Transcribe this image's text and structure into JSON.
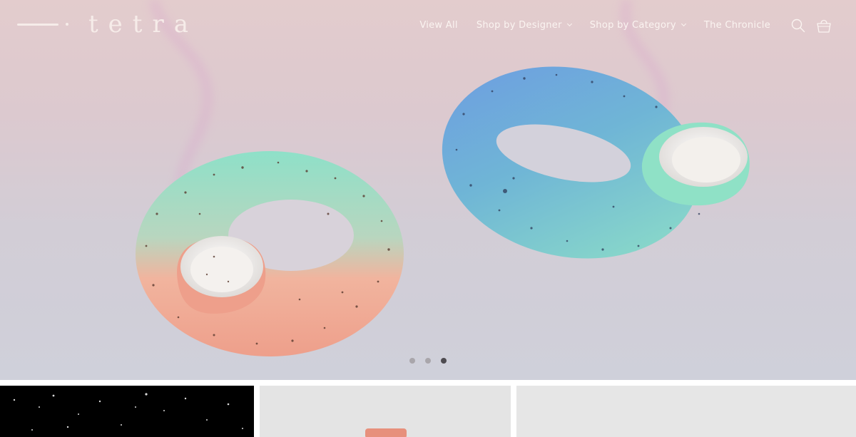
{
  "brand": {
    "name": "tetra"
  },
  "nav": {
    "items": [
      {
        "label": "View All",
        "has_dropdown": false
      },
      {
        "label": "Shop by Designer",
        "has_dropdown": true
      },
      {
        "label": "Shop by Category",
        "has_dropdown": true
      },
      {
        "label": "The Chronicle",
        "has_dropdown": false
      }
    ],
    "search_icon": "search-icon",
    "cart_icon": "shopping-bag-icon"
  },
  "hero": {
    "slide_count": 3,
    "active_slide": 3
  },
  "colors": {
    "header_text": "#fbf4f1",
    "hero_background": "#dccbd2",
    "dot_inactive": "#a9a6ab",
    "dot_active": "#4e4b50",
    "tile_dark": "#000000",
    "tile_light": "#e4e4e4"
  }
}
